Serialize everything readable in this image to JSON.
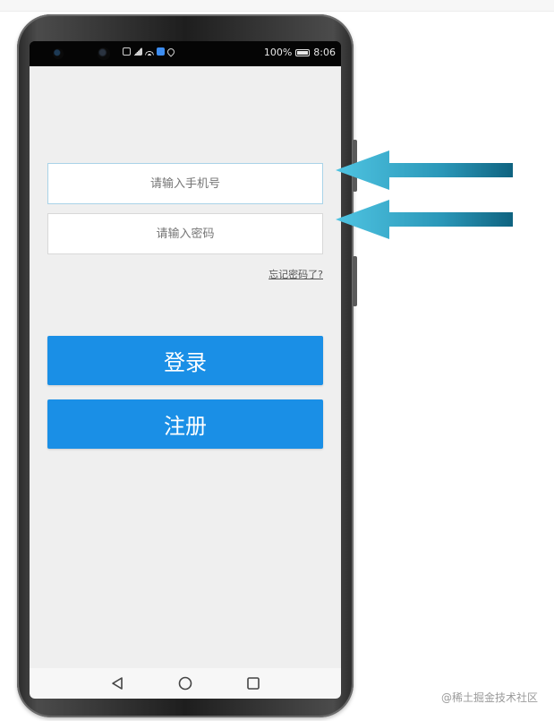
{
  "status_bar": {
    "battery_percent": "100%",
    "time": "8:06"
  },
  "login_form": {
    "phone_placeholder": "请输入手机号",
    "password_placeholder": "请输入密码",
    "forgot_password": "忘记密码了?",
    "login_label": "登录",
    "register_label": "注册"
  },
  "nav_bar": {
    "icons": [
      "back-icon",
      "home-icon",
      "recents-icon"
    ]
  },
  "watermark": "@稀土掘金技术社区",
  "colors": {
    "accent": "#1a8fe6",
    "arrow": "#2aa8c8",
    "background": "#efefef"
  }
}
